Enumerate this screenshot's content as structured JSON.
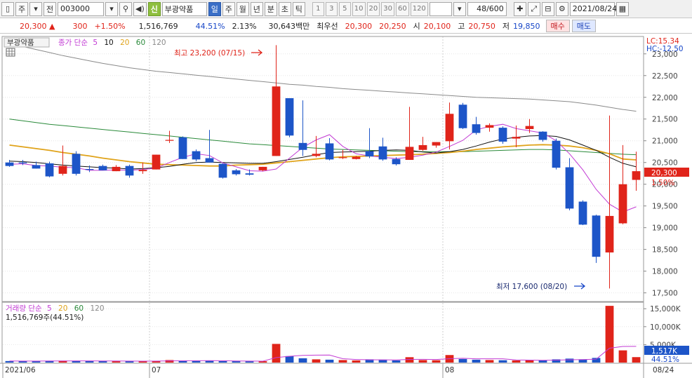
{
  "toolbar": {
    "market": "주",
    "full": "전",
    "code": "003000",
    "sin": "신",
    "stock_name": "부광약품",
    "periods": [
      "일",
      "주",
      "월",
      "년",
      "분",
      "초",
      "틱"
    ],
    "active_period": "일",
    "intervals": [
      "1",
      "3",
      "5",
      "10",
      "20",
      "30",
      "60",
      "120"
    ],
    "count": "48/600",
    "date": "2021/08/24"
  },
  "quote": {
    "price": "20,300",
    "change": "300",
    "change_pct": "+1.50%",
    "volume": "1,516,769",
    "vol_ratio": "44.51%",
    "turnover": "2.13%",
    "amount": "30,643백만",
    "best_label": "최우선",
    "ask": "20,300",
    "bid": "20,250",
    "open_label": "시",
    "open": "20,100",
    "high_label": "고",
    "high": "20,750",
    "low_label": "저",
    "low": "19,850",
    "buy_label": "매수",
    "sell_label": "매도"
  },
  "price_panel": {
    "title": "부광약품",
    "legend_prefix": "종가 단순",
    "ma_labels": [
      "5",
      "10",
      "20",
      "60",
      "120"
    ],
    "lc": "LC:15.34",
    "hc": "HC:-12.50",
    "y_ticks": [
      "23,000",
      "22,500",
      "22,000",
      "21,500",
      "21,000",
      "20,500",
      "20,000",
      "19,500",
      "19,000",
      "18,500",
      "18,000",
      "17,500"
    ],
    "current_price_tag": "20,300",
    "current_pct_tag": "1.50%",
    "high_annotation": "최고 23,200 (07/15)",
    "low_annotation": "최저 17,600 (08/20)"
  },
  "volume_panel": {
    "legend_prefix": "거래량 단순",
    "ma_labels": [
      "5",
      "20",
      "60",
      "120"
    ],
    "current_volume": "1,516,769주(44.51%)",
    "y_ticks": [
      "15,000K",
      "10,000K",
      "5,000K"
    ],
    "current_tag": "1,517K",
    "pct_tag": "44.51%"
  },
  "x_labels": [
    "2021/06",
    "07",
    "08",
    "08/24"
  ],
  "colors": {
    "up": "#e0241a",
    "down": "#1d55c8",
    "ma5": "#c23bd4",
    "ma10": "#111111",
    "ma20": "#e0a31a",
    "ma60": "#2a8a3a",
    "ma120": "#8a8a8a"
  },
  "chart_data": {
    "type": "candlestick",
    "y_range": [
      17300,
      23400
    ],
    "volume_range_k": [
      0,
      16800
    ],
    "candles": [
      {
        "o": 20500,
        "h": 20560,
        "l": 20400,
        "c": 20420
      },
      {
        "o": 20500,
        "h": 20560,
        "l": 20440,
        "c": 20480
      },
      {
        "o": 20440,
        "h": 20520,
        "l": 20360,
        "c": 20360
      },
      {
        "o": 20480,
        "h": 20520,
        "l": 20160,
        "c": 20180
      },
      {
        "o": 20240,
        "h": 20890,
        "l": 20200,
        "c": 20420
      },
      {
        "o": 20700,
        "h": 20760,
        "l": 20200,
        "c": 20240
      },
      {
        "o": 20350,
        "h": 20430,
        "l": 20280,
        "c": 20330
      },
      {
        "o": 20420,
        "h": 20450,
        "l": 20320,
        "c": 20320
      },
      {
        "o": 20300,
        "h": 20440,
        "l": 20300,
        "c": 20400
      },
      {
        "o": 20420,
        "h": 20450,
        "l": 20150,
        "c": 20200
      },
      {
        "o": 20300,
        "h": 20500,
        "l": 20240,
        "c": 20330
      },
      {
        "o": 20340,
        "h": 20680,
        "l": 20340,
        "c": 20680
      },
      {
        "o": 21000,
        "h": 21230,
        "l": 20950,
        "c": 21020
      },
      {
        "o": 21080,
        "h": 21100,
        "l": 20580,
        "c": 20580
      },
      {
        "o": 20760,
        "h": 20800,
        "l": 20530,
        "c": 20570
      },
      {
        "o": 20600,
        "h": 21250,
        "l": 20580,
        "c": 20500
      },
      {
        "o": 20470,
        "h": 20480,
        "l": 20130,
        "c": 20150
      },
      {
        "o": 20320,
        "h": 20350,
        "l": 20200,
        "c": 20230
      },
      {
        "o": 20250,
        "h": 20340,
        "l": 20200,
        "c": 20220
      },
      {
        "o": 20320,
        "h": 20400,
        "l": 20300,
        "c": 20400
      },
      {
        "o": 20650,
        "h": 23200,
        "l": 20650,
        "c": 22250
      },
      {
        "o": 21980,
        "h": 21980,
        "l": 21080,
        "c": 21120
      },
      {
        "o": 20950,
        "h": 21930,
        "l": 20650,
        "c": 20790
      },
      {
        "o": 20650,
        "h": 21110,
        "l": 20620,
        "c": 20700
      },
      {
        "o": 20940,
        "h": 21060,
        "l": 20550,
        "c": 20570
      },
      {
        "o": 20610,
        "h": 20790,
        "l": 20580,
        "c": 20620
      },
      {
        "o": 20580,
        "h": 20650,
        "l": 20570,
        "c": 20630
      },
      {
        "o": 20760,
        "h": 21290,
        "l": 20600,
        "c": 20640
      },
      {
        "o": 20870,
        "h": 21070,
        "l": 20540,
        "c": 20570
      },
      {
        "o": 20580,
        "h": 20620,
        "l": 20430,
        "c": 20460
      },
      {
        "o": 20560,
        "h": 21780,
        "l": 20560,
        "c": 20860
      },
      {
        "o": 20790,
        "h": 21090,
        "l": 20770,
        "c": 20900
      },
      {
        "o": 20890,
        "h": 20970,
        "l": 20840,
        "c": 20970
      },
      {
        "o": 20990,
        "h": 21880,
        "l": 20800,
        "c": 21620
      },
      {
        "o": 21830,
        "h": 21870,
        "l": 21270,
        "c": 21290
      },
      {
        "o": 21380,
        "h": 21550,
        "l": 21140,
        "c": 21180
      },
      {
        "o": 21300,
        "h": 21400,
        "l": 21210,
        "c": 21360
      },
      {
        "o": 21300,
        "h": 21330,
        "l": 20930,
        "c": 20980
      },
      {
        "o": 21050,
        "h": 21350,
        "l": 20850,
        "c": 21090
      },
      {
        "o": 21270,
        "h": 21500,
        "l": 21180,
        "c": 21340
      },
      {
        "o": 21210,
        "h": 21220,
        "l": 20980,
        "c": 21020
      },
      {
        "o": 21000,
        "h": 21050,
        "l": 20340,
        "c": 20380
      },
      {
        "o": 20390,
        "h": 20600,
        "l": 19400,
        "c": 19440
      },
      {
        "o": 19600,
        "h": 19630,
        "l": 19060,
        "c": 19070
      },
      {
        "o": 19280,
        "h": 19300,
        "l": 18190,
        "c": 18330
      },
      {
        "o": 18430,
        "h": 21580,
        "l": 17600,
        "c": 19270
      },
      {
        "o": 19100,
        "h": 20900,
        "l": 19080,
        "c": 20000
      },
      {
        "o": 20100,
        "h": 20750,
        "l": 19850,
        "c": 20300
      }
    ],
    "ma5": [
      20460,
      20470,
      20430,
      20420,
      20390,
      20380,
      20320,
      20320,
      20330,
      20320,
      20340,
      20370,
      20500,
      20620,
      20700,
      20660,
      20490,
      20400,
      20310,
      20300,
      20350,
      20600,
      20850,
      21020,
      21140,
      20870,
      20700,
      20650,
      20620,
      20590,
      20620,
      20670,
      20740,
      20870,
      21010,
      21250,
      21330,
      21380,
      21280,
      21230,
      21180,
      21000,
      20700,
      20330,
      19880,
      19540,
      19360,
      19480
    ],
    "ma10": [
      20530,
      20520,
      20500,
      20470,
      20440,
      20420,
      20400,
      20380,
      20370,
      20350,
      20360,
      20380,
      20410,
      20460,
      20500,
      20510,
      20500,
      20490,
      20480,
      20480,
      20520,
      20570,
      20620,
      20680,
      20730,
      20740,
      20750,
      20760,
      20780,
      20790,
      20780,
      20740,
      20720,
      20750,
      20800,
      20880,
      20970,
      21040,
      21080,
      21110,
      21120,
      21100,
      21020,
      20900,
      20780,
      20620,
      20480,
      20400
    ],
    "ma20": [
      20900,
      20860,
      20820,
      20780,
      20730,
      20690,
      20650,
      20600,
      20560,
      20520,
      20490,
      20460,
      20450,
      20440,
      20430,
      20420,
      20420,
      20440,
      20450,
      20460,
      20490,
      20520,
      20550,
      20580,
      20610,
      20630,
      20640,
      20650,
      20660,
      20670,
      20680,
      20690,
      20710,
      20730,
      20760,
      20800,
      20830,
      20860,
      20880,
      20900,
      20910,
      20900,
      20880,
      20840,
      20780,
      20700,
      20580,
      20560
    ],
    "ma60": [
      21500,
      21460,
      21420,
      21380,
      21350,
      21320,
      21290,
      21260,
      21230,
      21200,
      21170,
      21140,
      21110,
      21080,
      21050,
      21020,
      20990,
      20960,
      20930,
      20910,
      20890,
      20870,
      20850,
      20830,
      20810,
      20800,
      20790,
      20780,
      20770,
      20760,
      20750,
      20750,
      20750,
      20750,
      20750,
      20760,
      20770,
      20780,
      20790,
      20800,
      20800,
      20790,
      20770,
      20750,
      20730,
      20710,
      20690,
      20680
    ],
    "ma120": [
      23250,
      23170,
      23100,
      23030,
      22960,
      22900,
      22840,
      22780,
      22730,
      22680,
      22640,
      22600,
      22570,
      22540,
      22510,
      22480,
      22450,
      22420,
      22390,
      22360,
      22330,
      22300,
      22280,
      22250,
      22230,
      22200,
      22180,
      22160,
      22140,
      22120,
      22100,
      22080,
      22060,
      22040,
      22020,
      22000,
      21990,
      21980,
      21970,
      21960,
      21940,
      21920,
      21900,
      21860,
      21820,
      21770,
      21720,
      21680
    ],
    "volume_k": [
      420,
      400,
      380,
      500,
      520,
      460,
      420,
      390,
      380,
      420,
      400,
      460,
      700,
      520,
      450,
      480,
      400,
      380,
      360,
      380,
      5200,
      1800,
      1200,
      900,
      800,
      700,
      600,
      900,
      800,
      600,
      1500,
      700,
      650,
      2100,
      1000,
      800,
      700,
      650,
      600,
      700,
      600,
      900,
      1100,
      900,
      1300,
      15800,
      3400,
      1517
    ],
    "volume_ma5_k": [
      430,
      420,
      410,
      430,
      440,
      460,
      460,
      450,
      430,
      410,
      400,
      410,
      470,
      490,
      510,
      520,
      500,
      450,
      410,
      400,
      1380,
      1760,
      2000,
      2080,
      2100,
      1080,
      860,
      780,
      760,
      720,
      880,
      900,
      850,
      1070,
      1190,
      1050,
      1050,
      1050,
      750,
      690,
      650,
      690,
      790,
      840,
      960,
      4000,
      4500,
      4520
    ]
  }
}
